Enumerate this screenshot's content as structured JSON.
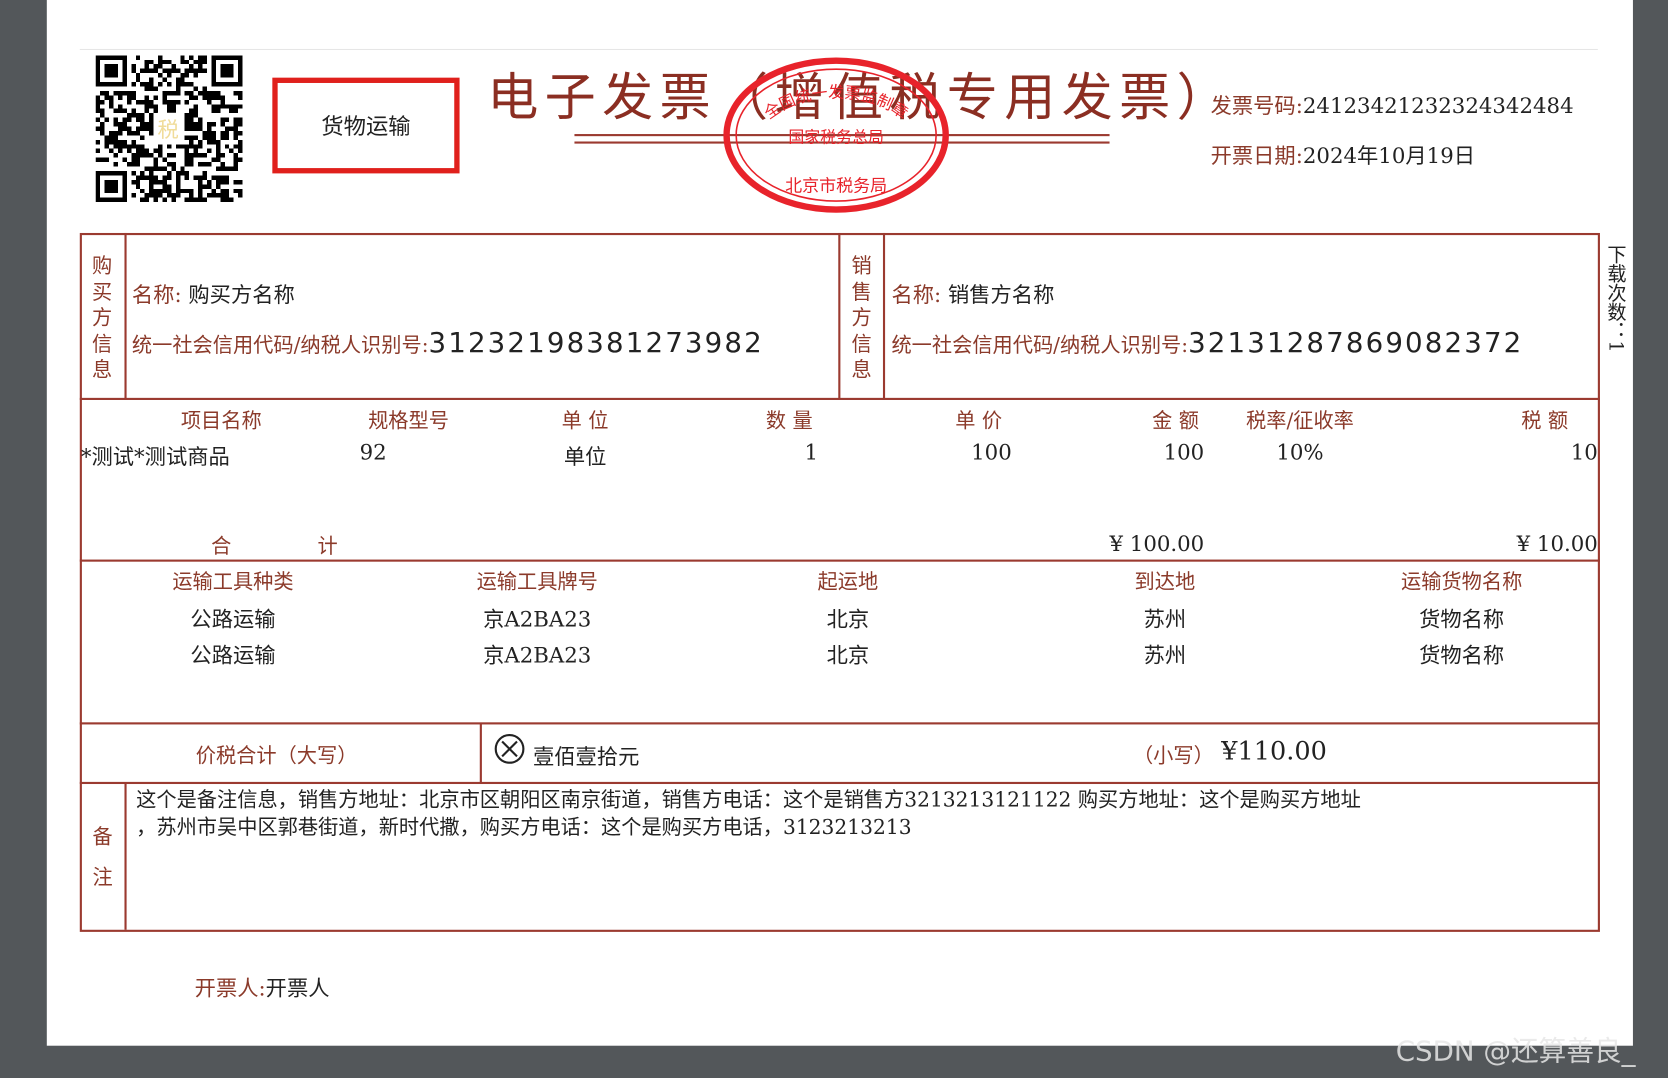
{
  "header": {
    "title": "电子发票（增值税专用发票）",
    "category_box": "货物运输",
    "invoice_number_label": "发票号码:",
    "invoice_number": "24123421232324342484",
    "issue_date_label": "开票日期:",
    "issue_date": "2024年10月19日",
    "qr_center_char": "税"
  },
  "stamp": {
    "top_text": "全国统一发票监制章",
    "middle_text": "国家税务总局",
    "bottom_text": "北京市税务局",
    "color": "#e8232b"
  },
  "side_note": "下载次数：1",
  "buyer": {
    "section_label": "购买方信息",
    "name_label": "名称:",
    "name": "购买方名称",
    "tax_id_label": "统一社会信用代码/纳税人识别号:",
    "tax_id": "31232198381273982"
  },
  "seller": {
    "section_label": "销售方信息",
    "name_label": "名称:",
    "name": "销售方名称",
    "tax_id_label": "统一社会信用代码/纳税人识别号:",
    "tax_id": "32131287869082372"
  },
  "items": {
    "headers": [
      "项目名称",
      "规格型号",
      "单 位",
      "数 量",
      "单 价",
      "金 额",
      "税率/征收率",
      "税 额"
    ],
    "rows": [
      [
        "*测试*测试商品",
        "92",
        "单位",
        "1",
        "100",
        "100",
        "10%",
        "10"
      ]
    ],
    "total_label_1": "合",
    "total_label_2": "计",
    "total_amount": "¥ 100.00",
    "total_tax": "¥ 10.00"
  },
  "transport": {
    "headers": [
      "运输工具种类",
      "运输工具牌号",
      "起运地",
      "到达地",
      "运输货物名称"
    ],
    "rows": [
      [
        "公路运输",
        "京A2BA23",
        "北京",
        "苏州",
        "货物名称"
      ],
      [
        "公路运输",
        "京A2BA23",
        "北京",
        "苏州",
        "货物名称"
      ]
    ]
  },
  "grand_total": {
    "label": "价税合计（大写）",
    "amount_words": "壹佰壹拾元",
    "small_label": "（小写）",
    "amount": "¥110.00"
  },
  "remarks": {
    "label_1": "备",
    "label_2": "注",
    "line_1": "这个是备注信息，销售方地址：北京市区朝阳区南京街道，销售方电话：这个是销售方3213213121122 购买方地址：这个是购买方地址",
    "line_2": "，苏州市吴中区郭巷街道，新时代撒，购买方电话：这个是购买方电话，3123213213"
  },
  "footer": {
    "issuer_label": "开票人:",
    "issuer": "开票人"
  },
  "watermark": "CSDN @还算善良_",
  "colors": {
    "label": "#8b3a2a",
    "line": "#9b3a30",
    "box": "#e0201c",
    "background": "#53575a"
  }
}
